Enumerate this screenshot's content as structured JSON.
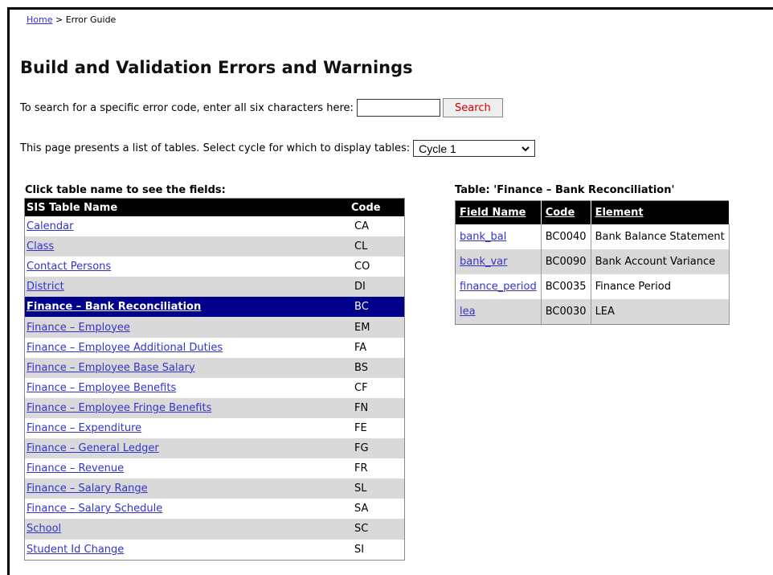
{
  "breadcrumb": {
    "home": "Home",
    "separator": " > ",
    "current": "Error Guide"
  },
  "title": "Build and Validation Errors and Warnings",
  "search": {
    "label": "To search for a specific error code, enter all six characters here:",
    "value": "",
    "button": "Search"
  },
  "cycle": {
    "label": "This page presents a list of tables. Select cycle for which to display tables:",
    "selected": "Cycle 1",
    "chevron": "chevron-down-icon"
  },
  "left_table": {
    "caption": "Click table name to see the fields:",
    "headers": [
      "SIS Table Name",
      "Code"
    ],
    "rows": [
      {
        "name": "Calendar",
        "code": "CA"
      },
      {
        "name": "Class",
        "code": "CL"
      },
      {
        "name": "Contact Persons",
        "code": "CO"
      },
      {
        "name": "District",
        "code": "DI"
      },
      {
        "name": "Finance – Bank Reconciliation",
        "code": "BC"
      },
      {
        "name": "Finance – Employee",
        "code": "EM"
      },
      {
        "name": "Finance – Employee Additional Duties",
        "code": "FA"
      },
      {
        "name": "Finance – Employee Base Salary",
        "code": "BS"
      },
      {
        "name": "Finance – Employee Benefits",
        "code": "CF"
      },
      {
        "name": "Finance – Employee Fringe Benefits",
        "code": "FN"
      },
      {
        "name": "Finance – Expenditure",
        "code": "FE"
      },
      {
        "name": "Finance – General Ledger",
        "code": "FG"
      },
      {
        "name": "Finance – Revenue",
        "code": "FR"
      },
      {
        "name": "Finance – Salary Range",
        "code": "SL"
      },
      {
        "name": "Finance – Salary Schedule",
        "code": "SA"
      },
      {
        "name": "School",
        "code": "SC"
      },
      {
        "name": "Student Id Change",
        "code": "SI"
      }
    ]
  },
  "right_table": {
    "caption": "Table: 'Finance – Bank Reconciliation'",
    "headers": [
      "Field Name",
      "Code",
      "Element"
    ],
    "rows": [
      {
        "field": "bank_bal",
        "code": "BC0040",
        "element": "Bank Balance Statement"
      },
      {
        "field": "bank_var",
        "code": "BC0090",
        "element": "Bank Account Variance"
      },
      {
        "field": "finance_period",
        "code": "BC0035",
        "element": "Finance Period"
      },
      {
        "field": "lea",
        "code": "BC0030",
        "element": "LEA"
      }
    ]
  },
  "colors": {
    "selected_row": "#00008b",
    "stripe": "#d9d9d9",
    "link": "#3333cc",
    "search_text": "#d00000"
  }
}
